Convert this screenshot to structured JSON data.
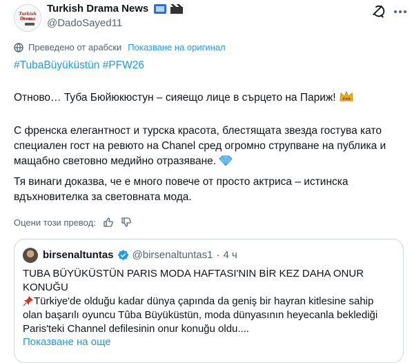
{
  "post": {
    "author_name": "Turkish Drama News",
    "author_handle": "@DadoSayed11",
    "avatar_text_line1": "Turkish Drama",
    "avatar_text_line2": "News",
    "translated_label": "Преведено от арабски",
    "show_original_label": "Показване на оригинал",
    "hashtags": "#TubaBüyüküstün #PFW26",
    "paragraph_1": "Отново… Туба Бюйюкюстун – сияещо лице в сърцето на Париж!",
    "paragraph_2": "С френска елегантност и турска красота, блестящата звезда гостува като специален гост на ревюто на Chanel сред огромно струпване на публика и мащабно световно медийно отразяване.",
    "paragraph_3": "Тя винаги доказва, че е много повече от просто актриса – истинска вдъхновителка за световната мода.",
    "rate_translation_label": "Оцени този превод:"
  },
  "quoted": {
    "author_name": "birsenaltuntas",
    "author_handle": "@birsenaltuntas1",
    "time": "4 ч",
    "text_line_1": "TUBA BÜYÜKÜSTÜN PARIS MODA HAFTASI'NIN BİR KEZ DAHA ONUR KONUĞU",
    "text_line_2": "Türkiye'de olduğu kadar dünya çapında da geniş bir hayran kitlesine sahip olan başarılı oyuncu Tûba Büyüküstün, moda dünyasının heyecanla beklediği Paris'teki Channel defilesinin onur konuğu oldu....",
    "show_more_label": "Показване на още"
  },
  "icons": [
    "tv-icon",
    "clapper-icon",
    "grok-icon",
    "more-icon",
    "translate-icon",
    "crown-icon",
    "diamond-icon",
    "thumbs-up-icon",
    "thumbs-down-icon",
    "verified-badge-icon",
    "pushpin-icon"
  ],
  "colors": {
    "link": "#1d9bf0",
    "secondary_text": "#536471",
    "primary_text": "#0f1419",
    "border": "#cfd9de"
  }
}
